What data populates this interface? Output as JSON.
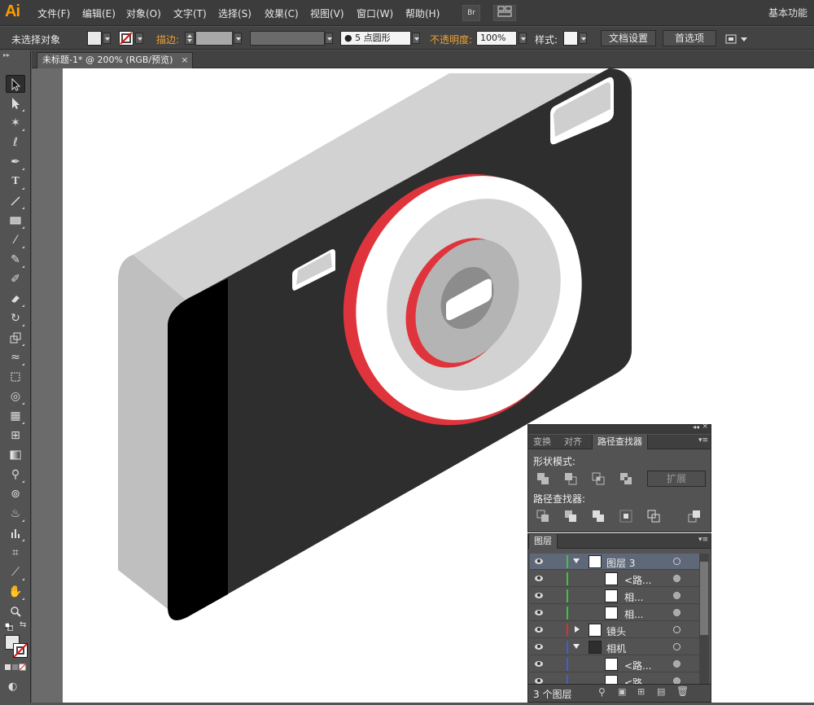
{
  "app": {
    "logo": "Ai",
    "menu": [
      "文件(F)",
      "编辑(E)",
      "对象(O)",
      "文字(T)",
      "选择(S)",
      "效果(C)",
      "视图(V)",
      "窗口(W)",
      "帮助(H)"
    ],
    "bridge_label": "Br",
    "workspace": "基本功能"
  },
  "controlbar": {
    "selection_status": "未选择对象",
    "stroke_label": "描边:",
    "brush_label": "5 点圆形",
    "opacity_label": "不透明度:",
    "opacity_value": "100%",
    "style_label": "样式:",
    "doc_setup_button": "文档设置",
    "preferences_button": "首选项"
  },
  "document": {
    "tab_title": "未标题-1* @ 200% (RGB/预览)",
    "tab_close": "×"
  },
  "pathfinder_panel": {
    "tabs": [
      "变换",
      "对齐",
      "路径查找器"
    ],
    "active_tab": "路径查找器",
    "shape_modes_label": "形状模式:",
    "expand_button": "扩展",
    "pathfinders_label": "路径查找器:"
  },
  "layers_panel": {
    "tab": "图层",
    "rows": [
      {
        "name": "图层 3",
        "level": 0,
        "expanded": true,
        "color": "#38c838",
        "selected": true
      },
      {
        "name": "<路...",
        "level": 1,
        "color": "#38c838"
      },
      {
        "name": "相...",
        "level": 1,
        "color": "#38c838"
      },
      {
        "name": "相...",
        "level": 1,
        "color": "#38c838"
      },
      {
        "name": "镜头",
        "level": 0,
        "expanded": false,
        "color": "#d83030"
      },
      {
        "name": "相机",
        "level": 0,
        "expanded": true,
        "color": "#3a5fd8"
      },
      {
        "name": "<路...",
        "level": 1,
        "color": "#3a5fd8"
      },
      {
        "name": "<路...",
        "level": 1,
        "color": "#3a5fd8"
      }
    ],
    "layer_count": "3 个图层"
  },
  "colors": {
    "camera_body": "#2e2e2e",
    "camera_side": "#c8c8c8",
    "lens_red": "#e0343c",
    "lens_white": "#ffffff",
    "lens_grey": "#b4b4b4"
  }
}
